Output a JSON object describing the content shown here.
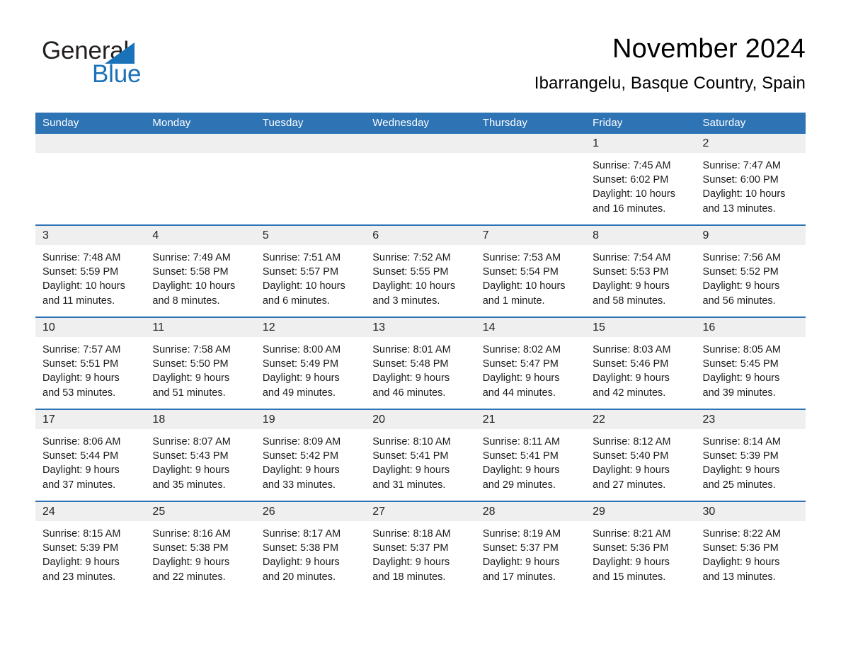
{
  "brand": {
    "name_part1": "General",
    "name_part2": "Blue",
    "accent_color": "#1a72b8"
  },
  "header": {
    "title": "November 2024",
    "subtitle": "Ibarrangelu, Basque Country, Spain"
  },
  "calendar": {
    "header_color": "#2e74b5",
    "daynum_band_color": "#efefef",
    "weekday_headers": [
      "Sunday",
      "Monday",
      "Tuesday",
      "Wednesday",
      "Thursday",
      "Friday",
      "Saturday"
    ],
    "weeks": [
      [
        {
          "day": "",
          "lines": []
        },
        {
          "day": "",
          "lines": []
        },
        {
          "day": "",
          "lines": []
        },
        {
          "day": "",
          "lines": []
        },
        {
          "day": "",
          "lines": []
        },
        {
          "day": "1",
          "lines": [
            "Sunrise: 7:45 AM",
            "Sunset: 6:02 PM",
            "Daylight: 10 hours",
            "and 16 minutes."
          ]
        },
        {
          "day": "2",
          "lines": [
            "Sunrise: 7:47 AM",
            "Sunset: 6:00 PM",
            "Daylight: 10 hours",
            "and 13 minutes."
          ]
        }
      ],
      [
        {
          "day": "3",
          "lines": [
            "Sunrise: 7:48 AM",
            "Sunset: 5:59 PM",
            "Daylight: 10 hours",
            "and 11 minutes."
          ]
        },
        {
          "day": "4",
          "lines": [
            "Sunrise: 7:49 AM",
            "Sunset: 5:58 PM",
            "Daylight: 10 hours",
            "and 8 minutes."
          ]
        },
        {
          "day": "5",
          "lines": [
            "Sunrise: 7:51 AM",
            "Sunset: 5:57 PM",
            "Daylight: 10 hours",
            "and 6 minutes."
          ]
        },
        {
          "day": "6",
          "lines": [
            "Sunrise: 7:52 AM",
            "Sunset: 5:55 PM",
            "Daylight: 10 hours",
            "and 3 minutes."
          ]
        },
        {
          "day": "7",
          "lines": [
            "Sunrise: 7:53 AM",
            "Sunset: 5:54 PM",
            "Daylight: 10 hours",
            "and 1 minute."
          ]
        },
        {
          "day": "8",
          "lines": [
            "Sunrise: 7:54 AM",
            "Sunset: 5:53 PM",
            "Daylight: 9 hours",
            "and 58 minutes."
          ]
        },
        {
          "day": "9",
          "lines": [
            "Sunrise: 7:56 AM",
            "Sunset: 5:52 PM",
            "Daylight: 9 hours",
            "and 56 minutes."
          ]
        }
      ],
      [
        {
          "day": "10",
          "lines": [
            "Sunrise: 7:57 AM",
            "Sunset: 5:51 PM",
            "Daylight: 9 hours",
            "and 53 minutes."
          ]
        },
        {
          "day": "11",
          "lines": [
            "Sunrise: 7:58 AM",
            "Sunset: 5:50 PM",
            "Daylight: 9 hours",
            "and 51 minutes."
          ]
        },
        {
          "day": "12",
          "lines": [
            "Sunrise: 8:00 AM",
            "Sunset: 5:49 PM",
            "Daylight: 9 hours",
            "and 49 minutes."
          ]
        },
        {
          "day": "13",
          "lines": [
            "Sunrise: 8:01 AM",
            "Sunset: 5:48 PM",
            "Daylight: 9 hours",
            "and 46 minutes."
          ]
        },
        {
          "day": "14",
          "lines": [
            "Sunrise: 8:02 AM",
            "Sunset: 5:47 PM",
            "Daylight: 9 hours",
            "and 44 minutes."
          ]
        },
        {
          "day": "15",
          "lines": [
            "Sunrise: 8:03 AM",
            "Sunset: 5:46 PM",
            "Daylight: 9 hours",
            "and 42 minutes."
          ]
        },
        {
          "day": "16",
          "lines": [
            "Sunrise: 8:05 AM",
            "Sunset: 5:45 PM",
            "Daylight: 9 hours",
            "and 39 minutes."
          ]
        }
      ],
      [
        {
          "day": "17",
          "lines": [
            "Sunrise: 8:06 AM",
            "Sunset: 5:44 PM",
            "Daylight: 9 hours",
            "and 37 minutes."
          ]
        },
        {
          "day": "18",
          "lines": [
            "Sunrise: 8:07 AM",
            "Sunset: 5:43 PM",
            "Daylight: 9 hours",
            "and 35 minutes."
          ]
        },
        {
          "day": "19",
          "lines": [
            "Sunrise: 8:09 AM",
            "Sunset: 5:42 PM",
            "Daylight: 9 hours",
            "and 33 minutes."
          ]
        },
        {
          "day": "20",
          "lines": [
            "Sunrise: 8:10 AM",
            "Sunset: 5:41 PM",
            "Daylight: 9 hours",
            "and 31 minutes."
          ]
        },
        {
          "day": "21",
          "lines": [
            "Sunrise: 8:11 AM",
            "Sunset: 5:41 PM",
            "Daylight: 9 hours",
            "and 29 minutes."
          ]
        },
        {
          "day": "22",
          "lines": [
            "Sunrise: 8:12 AM",
            "Sunset: 5:40 PM",
            "Daylight: 9 hours",
            "and 27 minutes."
          ]
        },
        {
          "day": "23",
          "lines": [
            "Sunrise: 8:14 AM",
            "Sunset: 5:39 PM",
            "Daylight: 9 hours",
            "and 25 minutes."
          ]
        }
      ],
      [
        {
          "day": "24",
          "lines": [
            "Sunrise: 8:15 AM",
            "Sunset: 5:39 PM",
            "Daylight: 9 hours",
            "and 23 minutes."
          ]
        },
        {
          "day": "25",
          "lines": [
            "Sunrise: 8:16 AM",
            "Sunset: 5:38 PM",
            "Daylight: 9 hours",
            "and 22 minutes."
          ]
        },
        {
          "day": "26",
          "lines": [
            "Sunrise: 8:17 AM",
            "Sunset: 5:38 PM",
            "Daylight: 9 hours",
            "and 20 minutes."
          ]
        },
        {
          "day": "27",
          "lines": [
            "Sunrise: 8:18 AM",
            "Sunset: 5:37 PM",
            "Daylight: 9 hours",
            "and 18 minutes."
          ]
        },
        {
          "day": "28",
          "lines": [
            "Sunrise: 8:19 AM",
            "Sunset: 5:37 PM",
            "Daylight: 9 hours",
            "and 17 minutes."
          ]
        },
        {
          "day": "29",
          "lines": [
            "Sunrise: 8:21 AM",
            "Sunset: 5:36 PM",
            "Daylight: 9 hours",
            "and 15 minutes."
          ]
        },
        {
          "day": "30",
          "lines": [
            "Sunrise: 8:22 AM",
            "Sunset: 5:36 PM",
            "Daylight: 9 hours",
            "and 13 minutes."
          ]
        }
      ]
    ]
  }
}
